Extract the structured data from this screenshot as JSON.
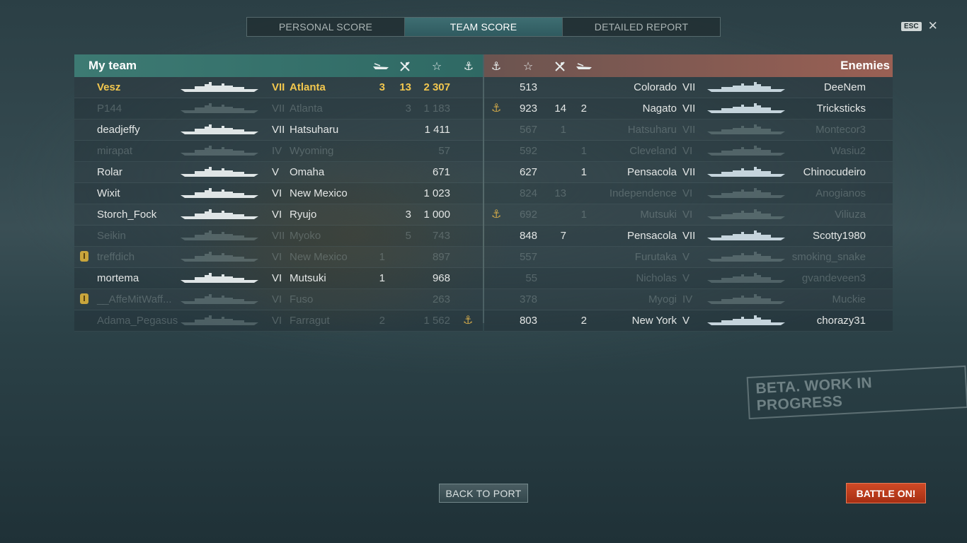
{
  "tabs": [
    "PERSONAL SCORE",
    "TEAM SCORE",
    "DETAILED REPORT"
  ],
  "active_tab": 1,
  "esc_label": "ESC",
  "my_team": {
    "title": "My team",
    "players": [
      {
        "name": "Vesz",
        "tier": "VII",
        "ship": "Atlanta",
        "ships_destroyed": "3",
        "planes_destroyed": "13",
        "xp": "2 307",
        "base": "",
        "medal": false,
        "state": "me"
      },
      {
        "name": "P144",
        "tier": "VII",
        "ship": "Atlanta",
        "ships_destroyed": "",
        "planes_destroyed": "3",
        "xp": "1 183",
        "base": "",
        "medal": false,
        "state": "dead"
      },
      {
        "name": "deadjeffy",
        "tier": "VII",
        "ship": "Hatsuharu",
        "ships_destroyed": "",
        "planes_destroyed": "",
        "xp": "1 411",
        "base": "",
        "medal": false,
        "state": "alive"
      },
      {
        "name": "mirapat",
        "tier": "IV",
        "ship": "Wyoming",
        "ships_destroyed": "",
        "planes_destroyed": "",
        "xp": "57",
        "base": "",
        "medal": false,
        "state": "dead"
      },
      {
        "name": "Rolar",
        "tier": "V",
        "ship": "Omaha",
        "ships_destroyed": "",
        "planes_destroyed": "",
        "xp": "671",
        "base": "",
        "medal": false,
        "state": "alive"
      },
      {
        "name": "Wixit",
        "tier": "VI",
        "ship": "New Mexico",
        "ships_destroyed": "",
        "planes_destroyed": "",
        "xp": "1 023",
        "base": "",
        "medal": false,
        "state": "alive"
      },
      {
        "name": "Storch_Fock",
        "tier": "VI",
        "ship": "Ryujo",
        "ships_destroyed": "",
        "planes_destroyed": "3",
        "xp": "1 000",
        "base": "",
        "medal": false,
        "state": "alive"
      },
      {
        "name": "Seikin",
        "tier": "VII",
        "ship": "Myoko",
        "ships_destroyed": "",
        "planes_destroyed": "5",
        "xp": "743",
        "base": "",
        "medal": false,
        "state": "dead"
      },
      {
        "name": "treffdich",
        "tier": "VI",
        "ship": "New Mexico",
        "ships_destroyed": "1",
        "planes_destroyed": "",
        "xp": "897",
        "base": "",
        "medal": true,
        "state": "dead"
      },
      {
        "name": "mortema",
        "tier": "VI",
        "ship": "Mutsuki",
        "ships_destroyed": "1",
        "planes_destroyed": "",
        "xp": "968",
        "base": "",
        "medal": false,
        "state": "alive"
      },
      {
        "name": "__AffeMitWaff...",
        "tier": "VI",
        "ship": "Fuso",
        "ships_destroyed": "",
        "planes_destroyed": "",
        "xp": "263",
        "base": "",
        "medal": true,
        "state": "dead"
      },
      {
        "name": "Adama_Pegasus",
        "tier": "VI",
        "ship": "Farragut",
        "ships_destroyed": "2",
        "planes_destroyed": "",
        "xp": "1 562",
        "base": "⚓",
        "medal": false,
        "state": "dead"
      }
    ]
  },
  "enemies": {
    "title": "Enemies",
    "players": [
      {
        "name": "DeeNem",
        "tier": "VII",
        "ship": "Colorado",
        "base": "",
        "xp": "513",
        "planes_destroyed": "",
        "ships_destroyed": "",
        "state": "alive"
      },
      {
        "name": "Tricksticks",
        "tier": "VII",
        "ship": "Nagato",
        "base": "⚓",
        "xp": "923",
        "planes_destroyed": "14",
        "ships_destroyed": "2",
        "state": "alive"
      },
      {
        "name": "Montecor3",
        "tier": "VII",
        "ship": "Hatsuharu",
        "base": "",
        "xp": "567",
        "planes_destroyed": "1",
        "ships_destroyed": "",
        "state": "dead"
      },
      {
        "name": "Wasiu2",
        "tier": "VI",
        "ship": "Cleveland",
        "base": "",
        "xp": "592",
        "planes_destroyed": "",
        "ships_destroyed": "1",
        "state": "dead"
      },
      {
        "name": "Chinocudeiro",
        "tier": "VII",
        "ship": "Pensacola",
        "base": "",
        "xp": "627",
        "planes_destroyed": "",
        "ships_destroyed": "1",
        "state": "alive"
      },
      {
        "name": "Anogianos",
        "tier": "VI",
        "ship": "Independence",
        "base": "",
        "xp": "824",
        "planes_destroyed": "13",
        "ships_destroyed": "",
        "state": "dead"
      },
      {
        "name": "Viliuza",
        "tier": "VI",
        "ship": "Mutsuki",
        "base": "⚓",
        "xp": "692",
        "planes_destroyed": "",
        "ships_destroyed": "1",
        "state": "dead"
      },
      {
        "name": "Scotty1980",
        "tier": "VII",
        "ship": "Pensacola",
        "base": "",
        "xp": "848",
        "planes_destroyed": "7",
        "ships_destroyed": "",
        "state": "alive"
      },
      {
        "name": "smoking_snake",
        "tier": "V",
        "ship": "Furutaka",
        "base": "",
        "xp": "557",
        "planes_destroyed": "",
        "ships_destroyed": "",
        "state": "dead"
      },
      {
        "name": "gvandeveen3",
        "tier": "V",
        "ship": "Nicholas",
        "base": "",
        "xp": "55",
        "planes_destroyed": "",
        "ships_destroyed": "",
        "state": "dead"
      },
      {
        "name": "Muckie",
        "tier": "IV",
        "ship": "Myogi",
        "base": "",
        "xp": "378",
        "planes_destroyed": "",
        "ships_destroyed": "",
        "state": "dead"
      },
      {
        "name": "chorazy31",
        "tier": "V",
        "ship": "New York",
        "base": "",
        "xp": "803",
        "planes_destroyed": "",
        "ships_destroyed": "2",
        "state": "alive"
      }
    ]
  },
  "beta_label": "BETA. WORK IN PROGRESS",
  "back_to_port_label": "BACK TO PORT",
  "battle_on_label": "BATTLE ON!"
}
